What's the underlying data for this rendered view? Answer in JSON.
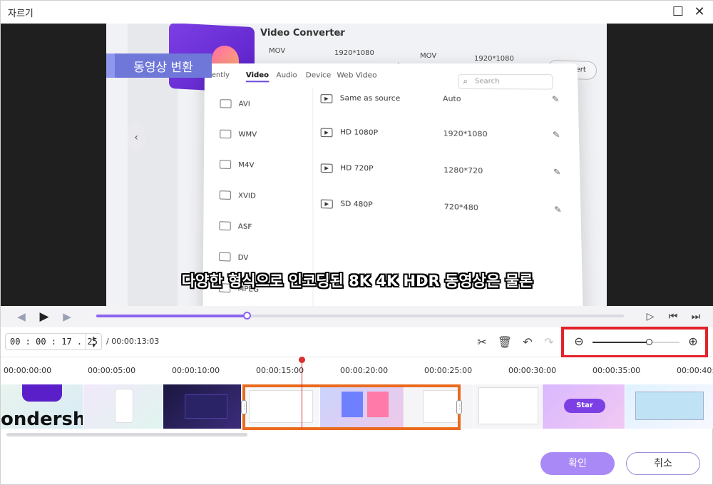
{
  "window": {
    "title": "자르기",
    "maximize_icon": "maximize-icon",
    "close_icon": "close-icon"
  },
  "preview": {
    "banner_text": "동영상 변환",
    "app_title": "Video Converter",
    "top_info": [
      "MOV",
      "1920*1080",
      "MOV",
      "1920*1080"
    ],
    "convert_label": "Convert",
    "tabs": [
      "ently",
      "Video",
      "Audio",
      "Device",
      "Web Video"
    ],
    "active_tab": "Video",
    "search_placeholder": "Search",
    "formats": [
      "AVI",
      "WMV",
      "M4V",
      "XVID",
      "ASF",
      "DV",
      "MPEG"
    ],
    "resolutions": [
      {
        "name": "Same as source",
        "size": "Auto"
      },
      {
        "name": "HD 1080P",
        "size": "1920*1080"
      },
      {
        "name": "HD 720P",
        "size": "1280*720"
      },
      {
        "name": "SD 480P",
        "size": "720*480"
      }
    ],
    "subtitle": "다양한 형식으로 인코딩된 8K 4K HDR 동영상은 물론"
  },
  "playback": {
    "progress": 0.285
  },
  "toolbar": {
    "current_time": "00 : 00 : 17 . 25",
    "total_time": "/ 00:00:13:03",
    "zoom_level": 0.65
  },
  "timeline": {
    "ticks": [
      "00:00:00:00",
      "00:00:05:00",
      "00:00:10:00",
      "00:00:15:00",
      "00:00:20:00",
      "00:00:25:00",
      "00:00:30:00",
      "00:00:35:00",
      "00:00:40:"
    ],
    "brand_fragment": "ondersha",
    "start_label": "Star"
  },
  "footer": {
    "confirm_label": "확인",
    "cancel_label": "취소"
  },
  "colors": {
    "accent": "#8b64f0",
    "highlight": "#e3222a",
    "selection": "#ea6a1e",
    "confirm_bg": "#a889f5"
  }
}
